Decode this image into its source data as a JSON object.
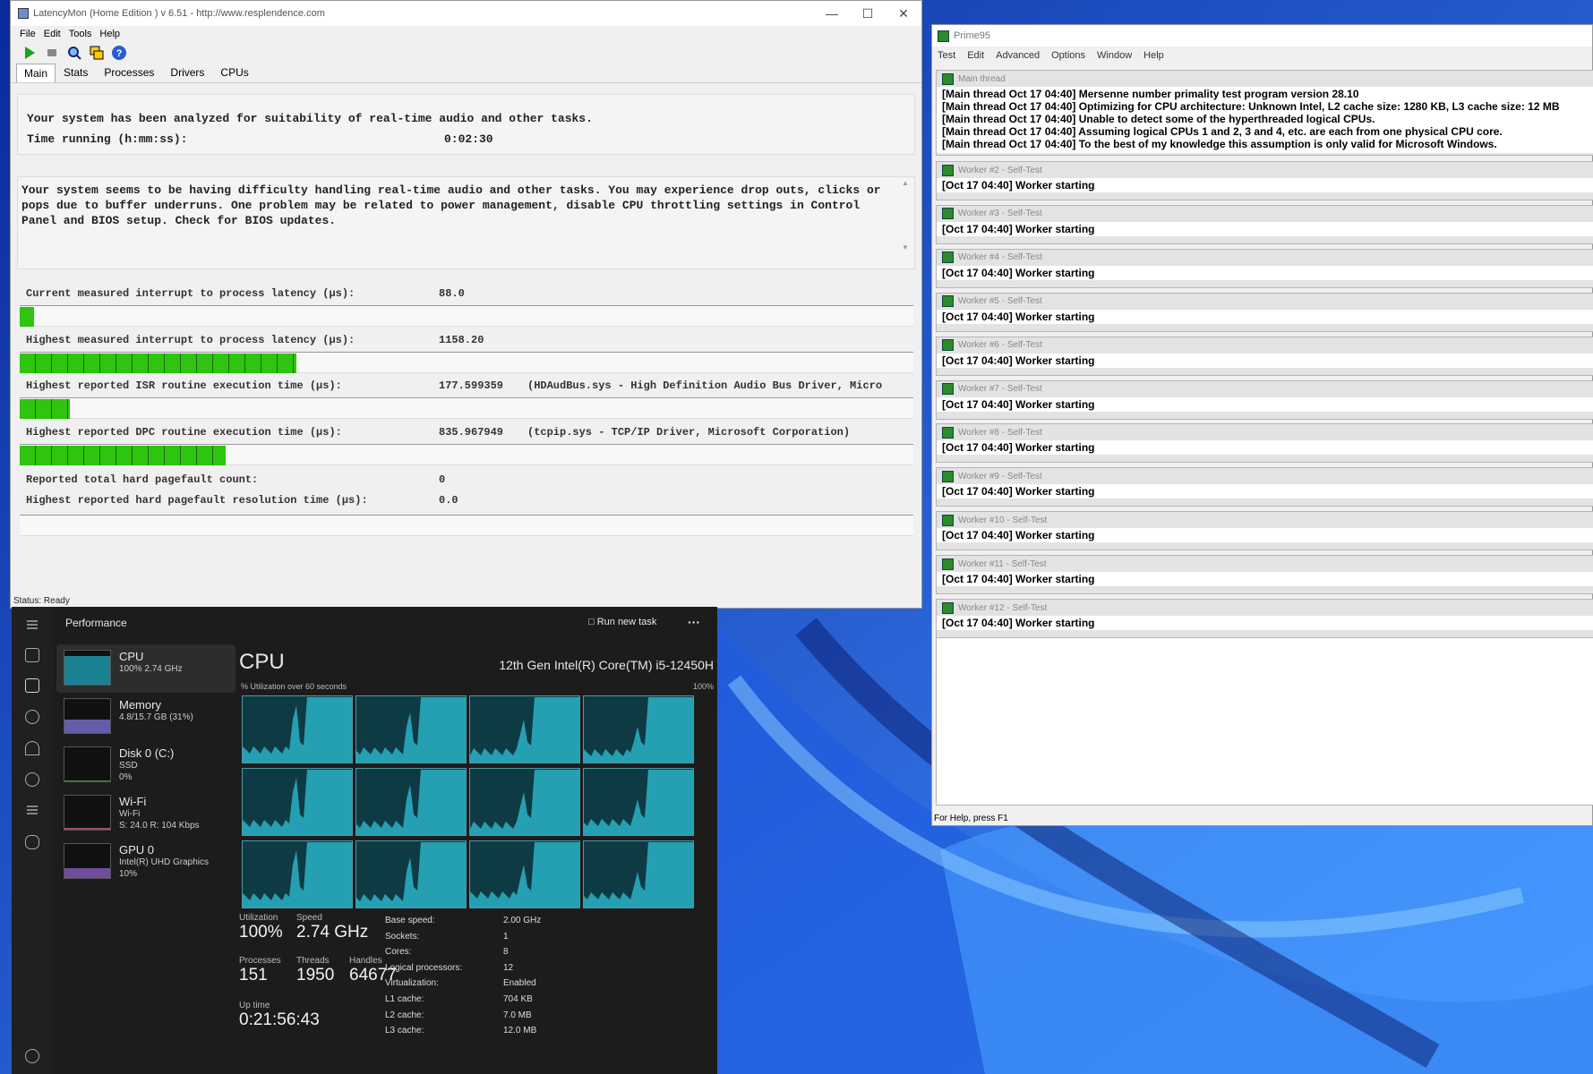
{
  "latencymon": {
    "title": "LatencyMon  (Home Edition )  v 6.51 - http://www.resplendence.com",
    "menu": [
      "File",
      "Edit",
      "Tools",
      "Help"
    ],
    "tabs": [
      "Main",
      "Stats",
      "Processes",
      "Drivers",
      "CPUs"
    ],
    "active_tab": "Main",
    "analyzed_line": "Your system has been analyzed for suitability of real-time audio and other tasks.",
    "time_running_label": "Time running (h:mm:ss):",
    "time_running_value": "0:02:30",
    "verdict": "Your system seems to be having difficulty handling real-time audio and other tasks. You may experience drop outs, clicks or pops due to buffer underruns. One problem may be related to power management, disable CPU throttling settings in Control Panel and BIOS setup. Check for BIOS updates.",
    "metrics": [
      {
        "label": "Current measured interrupt to process latency (µs):",
        "value": "88.0",
        "extra": "",
        "level": 0.016
      },
      {
        "label": "Highest measured interrupt to process latency (µs):",
        "value": "1158.20",
        "extra": "",
        "level": 0.31
      },
      {
        "label": "Highest reported ISR routine execution time (µs):",
        "value": "177.599359",
        "extra": "(HDAudBus.sys - High Definition Audio Bus Driver, Micro",
        "level": 0.056
      },
      {
        "label": "Highest reported DPC routine execution time (µs):",
        "value": "835.967949",
        "extra": "(tcpip.sys - TCP/IP Driver, Microsoft Corporation)",
        "level": 0.23
      }
    ],
    "pagefault_count_label": "Reported total hard pagefault count:",
    "pagefault_count_value": "0",
    "pagefault_time_label": "Highest reported hard pagefault resolution time (µs):",
    "pagefault_time_value": "0.0",
    "status": "Status: Ready"
  },
  "prime95": {
    "title": "Prime95",
    "menu": [
      "Test",
      "Edit",
      "Advanced",
      "Options",
      "Window",
      "Help"
    ],
    "main_thread_title": "Main thread",
    "main_lines": [
      "[Main thread Oct 17 04:40] Mersenne number primality test program version 28.10",
      "[Main thread Oct 17 04:40] Optimizing for CPU architecture: Unknown Intel, L2 cache size: 1280 KB, L3 cache size: 12 MB",
      "[Main thread Oct 17 04:40] Unable to detect some of the hyperthreaded logical CPUs.",
      "[Main thread Oct 17 04:40] Assuming logical CPUs 1 and 2, 3 and 4, etc. are each from one physical CPU core.",
      "[Main thread Oct 17 04:40] To the best of my knowledge this assumption is only valid for Microsoft Windows."
    ],
    "workers": [
      {
        "title": "Worker #2 - Self-Test",
        "line": "[Oct 17 04:40] Worker starting"
      },
      {
        "title": "Worker #3 - Self-Test",
        "line": "[Oct 17 04:40] Worker starting"
      },
      {
        "title": "Worker #4 - Self-Test",
        "line": "[Oct 17 04:40] Worker starting"
      },
      {
        "title": "Worker #5 - Self-Test",
        "line": "[Oct 17 04:40] Worker starting"
      },
      {
        "title": "Worker #6 - Self-Test",
        "line": "[Oct 17 04:40] Worker starting"
      },
      {
        "title": "Worker #7 - Self-Test",
        "line": "[Oct 17 04:40] Worker starting"
      },
      {
        "title": "Worker #8 - Self-Test",
        "line": "[Oct 17 04:40] Worker starting"
      },
      {
        "title": "Worker #9 - Self-Test",
        "line": "[Oct 17 04:40] Worker starting"
      },
      {
        "title": "Worker #10 - Self-Test",
        "line": "[Oct 17 04:40] Worker starting"
      },
      {
        "title": "Worker #11 - Self-Test",
        "line": "[Oct 17 04:40] Worker starting"
      },
      {
        "title": "Worker #12 - Self-Test",
        "line": "[Oct 17 04:40] Worker starting"
      }
    ],
    "status": "For Help, press F1"
  },
  "taskmgr": {
    "section": "Performance",
    "run_task": "Run new task",
    "more": "···",
    "sidebar": [
      {
        "name": "CPU",
        "sub1": "100% 2.74 GHz",
        "sub2": "",
        "color": "#1e9fb4"
      },
      {
        "name": "Memory",
        "sub1": "4.8/15.7 GB (31%)",
        "sub2": "",
        "color": "#7a6fd0"
      },
      {
        "name": "Disk 0 (C:)",
        "sub1": "SSD",
        "sub2": "0%",
        "color": "#4caf50"
      },
      {
        "name": "Wi-Fi",
        "sub1": "Wi-Fi",
        "sub2": "S: 24.0  R: 104 Kbps",
        "color": "#c05a8a"
      },
      {
        "name": "GPU 0",
        "sub1": "Intel(R) UHD Graphics",
        "sub2": "10%",
        "color": "#8a5ac0"
      }
    ],
    "cpu_title": "CPU",
    "cpu_model": "12th Gen Intel(R) Core(TM) i5-12450H",
    "util_caption": "% Utilization over 60 seconds",
    "util_max": "100%",
    "stats": {
      "utilization_label": "Utilization",
      "utilization": "100%",
      "speed_label": "Speed",
      "speed": "2.74 GHz",
      "processes_label": "Processes",
      "processes": "151",
      "threads_label": "Threads",
      "threads": "1950",
      "handles_label": "Handles",
      "handles": "64677",
      "uptime_label": "Up time",
      "uptime": "0:21:56:43"
    },
    "specs": [
      [
        "Base speed:",
        "2.00 GHz"
      ],
      [
        "Sockets:",
        "1"
      ],
      [
        "Cores:",
        "8"
      ],
      [
        "Logical processors:",
        "12"
      ],
      [
        "Virtualization:",
        "Enabled"
      ],
      [
        "L1 cache:",
        "704 KB"
      ],
      [
        "L2 cache:",
        "7.0 MB"
      ],
      [
        "L3 cache:",
        "12.0 MB"
      ]
    ]
  }
}
